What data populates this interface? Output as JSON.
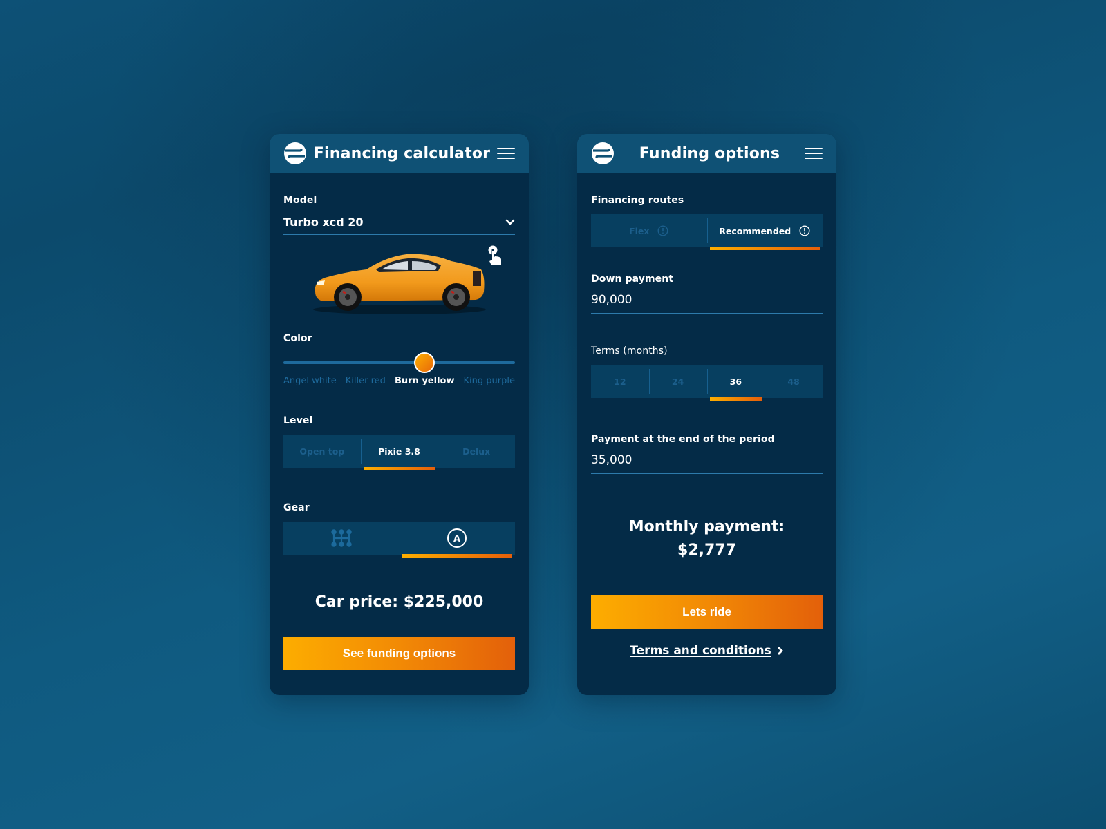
{
  "brand": {
    "accent_start": "#fdad00",
    "accent_end": "#e3600a",
    "card_bg": "#042b47",
    "header_bg": "#0f5175"
  },
  "calculator": {
    "title": "Financing calculator",
    "model": {
      "label": "Model",
      "value": "Turbo xcd 20"
    },
    "color": {
      "label": "Color",
      "options": [
        "Angel white",
        "Killer red",
        "Burn yellow",
        "King purple"
      ],
      "selected_index": 2
    },
    "level": {
      "label": "Level",
      "options": [
        "Open top",
        "Pixie 3.8",
        "Delux"
      ],
      "selected_index": 1
    },
    "gear": {
      "label": "Gear",
      "options": [
        {
          "icon": "manual-gear-icon"
        },
        {
          "icon": "automatic-gear-icon",
          "glyph": "A"
        }
      ],
      "selected_index": 1
    },
    "price": "Car price: $225,000",
    "cta": "See funding options"
  },
  "funding": {
    "title": "Funding options",
    "routes": {
      "label": "Financing routes",
      "options": [
        "Flex",
        "Recommended"
      ],
      "selected_index": 1
    },
    "down_payment": {
      "label": "Down payment",
      "value": "90,000"
    },
    "terms": {
      "label": "Terms (months)",
      "options": [
        "12",
        "24",
        "36",
        "48"
      ],
      "selected_index": 2
    },
    "end_payment": {
      "label": "Payment at the end of the period",
      "value": "35,000"
    },
    "monthly": {
      "label": "Monthly payment:",
      "value": "$2,777"
    },
    "cta": "Lets ride",
    "terms_link": "Terms and conditions"
  }
}
